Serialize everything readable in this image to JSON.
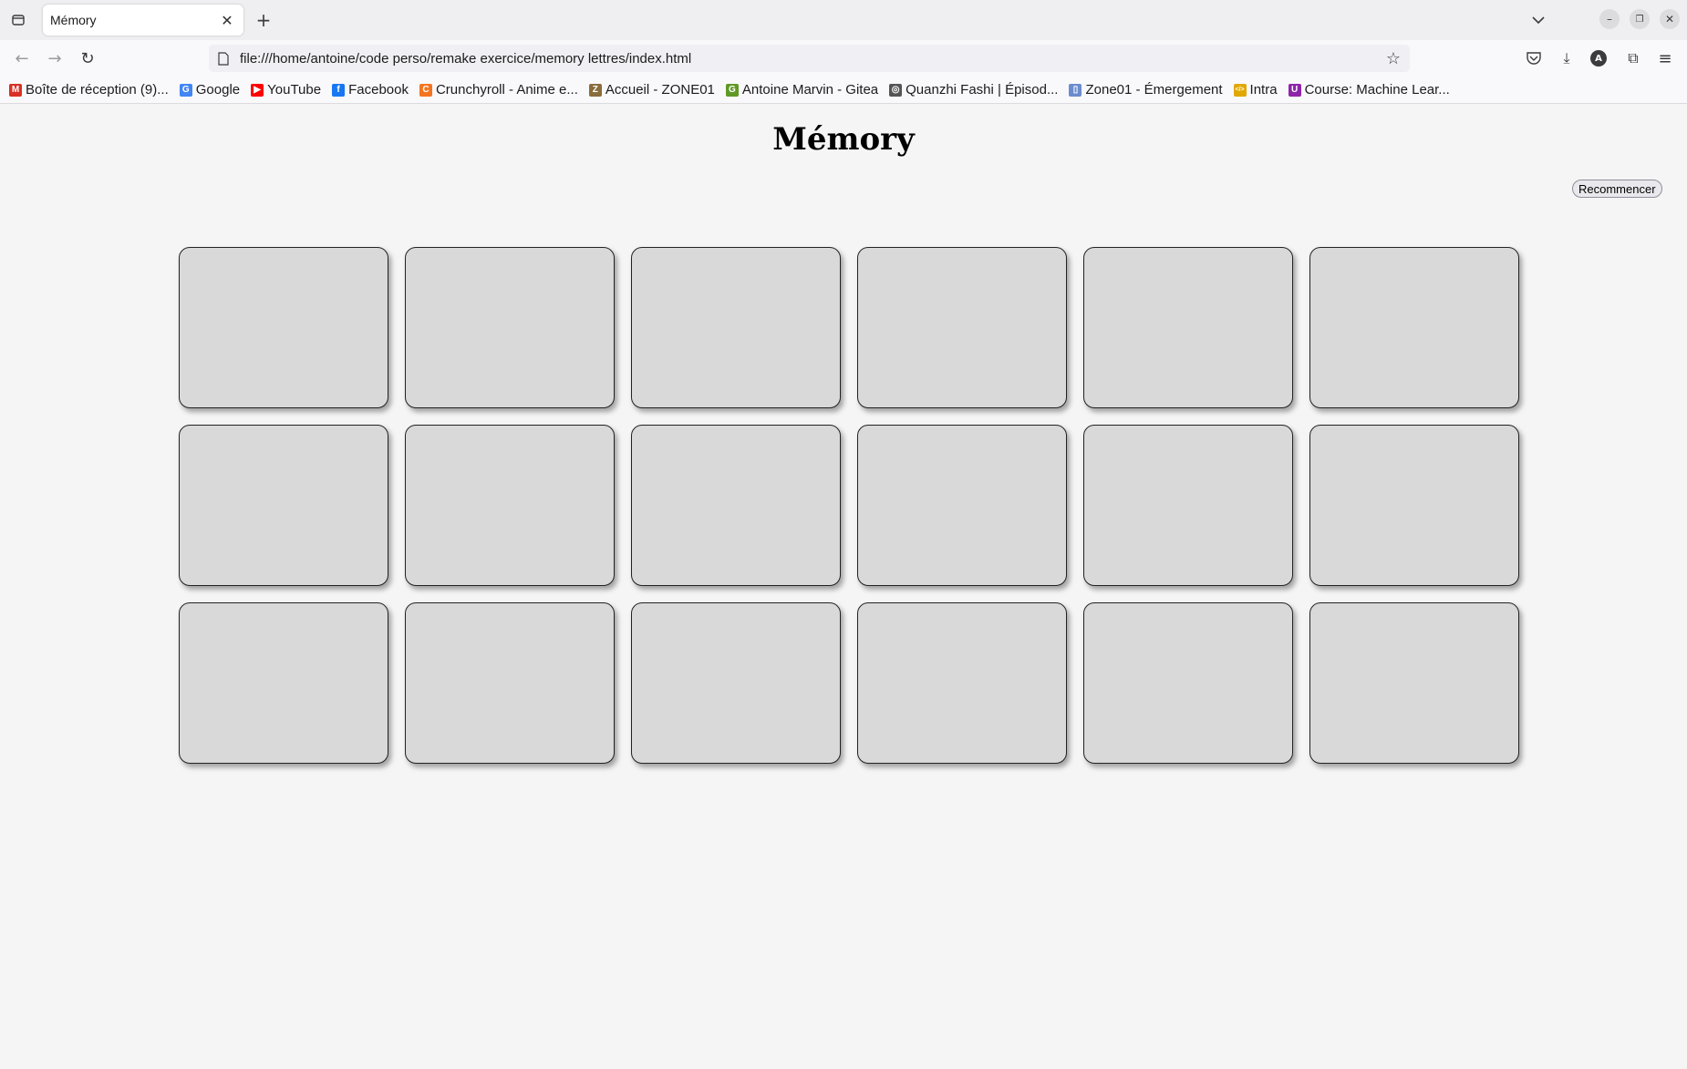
{
  "browser": {
    "tab_title": "Mémory",
    "url": "file:///home/antoine/code perso/remake exercice/memory lettres/index.html",
    "bookmarks": [
      {
        "label": "Boîte de réception (9)...",
        "icon": "gmail-icon",
        "color": "#d93025",
        "glyph": "M"
      },
      {
        "label": "Google",
        "icon": "google-icon",
        "color": "#4285f4",
        "glyph": "G"
      },
      {
        "label": "YouTube",
        "icon": "youtube-icon",
        "color": "#ff0000",
        "glyph": "▶"
      },
      {
        "label": "Facebook",
        "icon": "facebook-icon",
        "color": "#1877f2",
        "glyph": "f"
      },
      {
        "label": "Crunchyroll - Anime e...",
        "icon": "crunchyroll-icon",
        "color": "#f47521",
        "glyph": "C"
      },
      {
        "label": "Accueil - ZONE01",
        "icon": "zone01-icon",
        "color": "#8a6d3b",
        "glyph": "Z"
      },
      {
        "label": "Antoine Marvin - Gitea",
        "icon": "gitea-icon",
        "color": "#609926",
        "glyph": "G"
      },
      {
        "label": "Quanzhi Fashi | Épisod...",
        "icon": "globe-icon",
        "color": "#555555",
        "glyph": "◎"
      },
      {
        "label": "Zone01 - Émergement",
        "icon": "document-icon",
        "color": "#6b8cce",
        "glyph": "▯"
      },
      {
        "label": "Intra",
        "icon": "code-icon",
        "color": "#e0a800",
        "glyph": "</>"
      },
      {
        "label": "Course: Machine Lear...",
        "icon": "course-icon",
        "color": "#8e24aa",
        "glyph": "U"
      }
    ]
  },
  "page": {
    "title": "Mémory",
    "restart_label": "Recommencer",
    "card_count": 18,
    "columns": 6
  }
}
